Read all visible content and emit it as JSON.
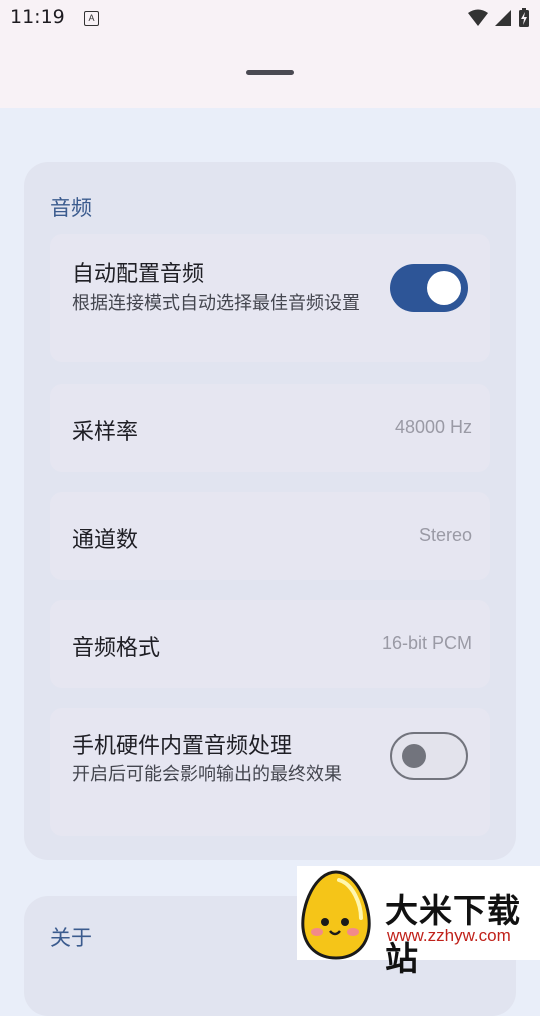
{
  "status_bar": {
    "time": "11:19",
    "keyboard_indicator": "A",
    "icons": [
      "wifi-icon",
      "signal-icon",
      "battery-charging-icon"
    ]
  },
  "audio_section": {
    "title": "音频",
    "auto_config": {
      "title": "自动配置音频",
      "description": "根据连接模式自动选择最佳音频设置",
      "enabled": true
    },
    "sample_rate": {
      "title": "采样率",
      "value": "48000 Hz"
    },
    "channels": {
      "title": "通道数",
      "value": "Stereo"
    },
    "format": {
      "title": "音频格式",
      "value": "16-bit PCM"
    },
    "hardware_processing": {
      "title": "手机硬件内置音频处理",
      "description": "开启后可能会影响输出的最终效果",
      "enabled": false
    }
  },
  "about_section": {
    "title": "关于"
  },
  "watermark": {
    "brand": "大米下载站",
    "url": "www.zzhyw.com",
    "colors": {
      "text": "#111111",
      "url": "#c0221b",
      "mascot": "#f5c518"
    }
  },
  "colors": {
    "accent": "#2d5597",
    "section_title": "#3b5b8e",
    "card_bg": "#e1e4f0",
    "page_bg": "#e9eef9"
  }
}
